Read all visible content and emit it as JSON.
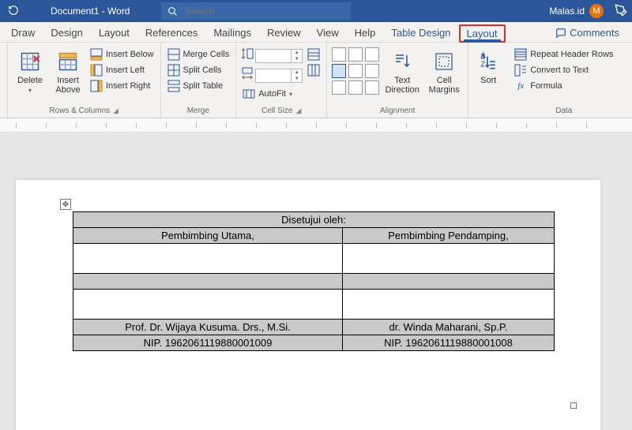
{
  "titlebar": {
    "doc_title": "Document1 - Word",
    "search_placeholder": "Search",
    "user_name": "Malas.id",
    "user_initial": "M"
  },
  "tabs": {
    "items": [
      "Draw",
      "Design",
      "Layout",
      "References",
      "Mailings",
      "Review",
      "View",
      "Help",
      "Table Design",
      "Layout"
    ],
    "active_index": 9,
    "context_start_index": 8,
    "comments_label": "Comments"
  },
  "ribbon": {
    "rows_cols": {
      "label": "Rows & Columns",
      "delete": "Delete",
      "insert_above": "Insert\nAbove",
      "insert_below": "Insert Below",
      "insert_left": "Insert Left",
      "insert_right": "Insert Right"
    },
    "merge": {
      "label": "Merge",
      "merge_cells": "Merge Cells",
      "split_cells": "Split Cells",
      "split_table": "Split Table"
    },
    "cell_size": {
      "label": "Cell Size",
      "autofit": "AutoFit"
    },
    "alignment": {
      "label": "Alignment",
      "text_direction": "Text\nDirection",
      "cell_margins": "Cell\nMargins"
    },
    "sort_group": {
      "sort": "Sort"
    },
    "data": {
      "label": "Data",
      "repeat_header": "Repeat Header Rows",
      "convert_text": "Convert to Text",
      "formula": "Formula"
    }
  },
  "document": {
    "table": {
      "header": "Disetujui oleh:",
      "col1_title": "Pembimbing Utama,",
      "col2_title": "Pembimbing Pendamping,",
      "col1_name": "Prof. Dr. Wijaya Kusuma. Drs., M.Si.",
      "col2_name": "dr. Winda Maharani, Sp.P.",
      "col1_nip": "NIP. 1962061119880001009",
      "col2_nip": "NIP. 1962061119880001008"
    }
  }
}
